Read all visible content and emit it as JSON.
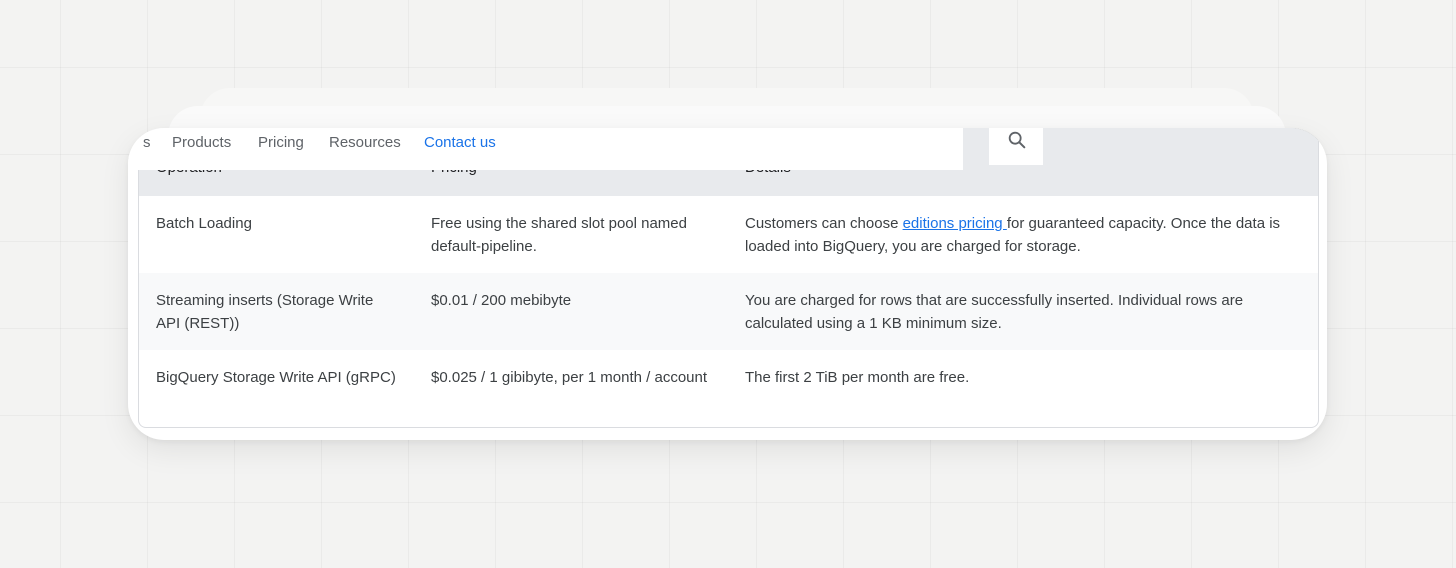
{
  "nav": {
    "cut_item": "s",
    "items": [
      "Products",
      "Pricing",
      "Resources"
    ],
    "active_item": "Contact us",
    "search_icon": "search-icon"
  },
  "table": {
    "headers": [
      "Operation",
      "Pricing",
      "Details"
    ],
    "rows": [
      {
        "operation": "Batch Loading",
        "pricing": "Free using the shared slot pool named default-pipeline.",
        "details_before": "Customers can choose ",
        "details_link": "editions pricing ",
        "details_after": "for guaranteed capacity. Once the data is loaded into BigQuery, you are charged for storage."
      },
      {
        "operation": "Streaming inserts (Storage Write API (REST))",
        "pricing": "$0.01 / 200 mebibyte",
        "details": "You are charged for rows that are successfully inserted. Individual rows are calculated using a 1 KB minimum size."
      },
      {
        "operation": "BigQuery Storage Write API (gRPC)",
        "pricing": "$0.025 / 1 gibibyte, per 1 month / account",
        "details": "The first 2 TiB per month are free."
      }
    ]
  },
  "colors": {
    "accent": "#1a73e8",
    "header_bg": "#e8eaed",
    "dark_bar": "#3c4043"
  }
}
